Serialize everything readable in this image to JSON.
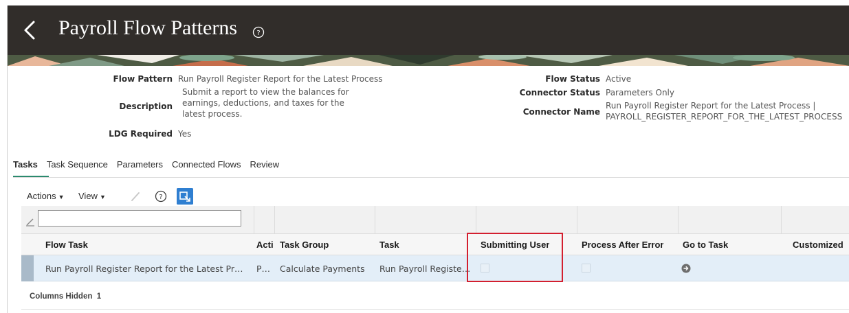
{
  "header": {
    "title": "Payroll Flow Patterns",
    "back_icon": "chevron-left-icon",
    "help_icon": "question-circle-icon"
  },
  "details": {
    "flow_pattern": {
      "label": "Flow Pattern",
      "value": "Run Payroll Register Report for the Latest Process"
    },
    "description": {
      "label": "Description",
      "value": "Submit a report to view the balances for earnings, deductions, and taxes for the latest process."
    },
    "ldg_required": {
      "label": "LDG Required",
      "value": "Yes"
    },
    "flow_status": {
      "label": "Flow Status",
      "value": "Active"
    },
    "connector_status": {
      "label": "Connector Status",
      "value": "Parameters Only"
    },
    "connector_name": {
      "label": "Connector Name",
      "value": "Run Payroll Register Report for the Latest Process | PAYROLL_REGISTER_REPORT_FOR_THE_LATEST_PROCESS"
    }
  },
  "tabs": [
    {
      "label": "Tasks",
      "active": true
    },
    {
      "label": "Task Sequence",
      "active": false
    },
    {
      "label": "Parameters",
      "active": false
    },
    {
      "label": "Connected Flows",
      "active": false
    },
    {
      "label": "Review",
      "active": false
    }
  ],
  "toolbar": {
    "actions_label": "Actions",
    "view_label": "View",
    "edit_icon": "pencil-icon",
    "help_icon": "question-circle-icon",
    "detach_icon": "detach-table-icon"
  },
  "table": {
    "filter_value": "",
    "columns": [
      "Flow Task",
      "Acti",
      "Task Group",
      "Task",
      "Submitting User",
      "Process After Error",
      "Go to Task",
      "Customized"
    ],
    "rows": [
      {
        "flow_task": "Run Payroll Register Report for the Latest Pr…",
        "action": "P…",
        "task_group": "Calculate Payments",
        "task": "Run Payroll Registe…",
        "submitting_user_checked": false,
        "process_after_error_checked": false,
        "go_to_task_icon": "arrow-circle-right-icon"
      }
    ],
    "columns_hidden_label": "Columns Hidden",
    "columns_hidden_count": "1"
  },
  "colors": {
    "header_bg": "#312d2a",
    "selected_row": "#e3eef8",
    "highlight": "#d31f2f",
    "tab_accent": "#2b8a6e",
    "detach_button": "#2f7fd1"
  }
}
